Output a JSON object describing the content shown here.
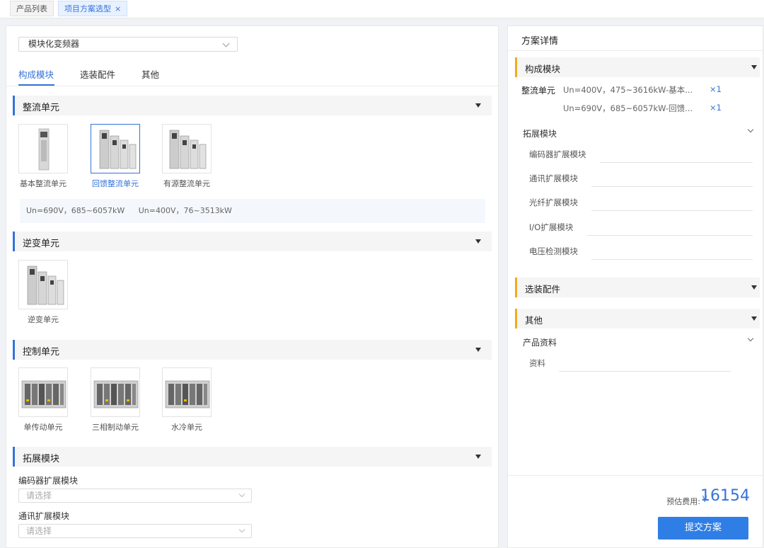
{
  "tabs": [
    {
      "label": "产品列表"
    },
    {
      "label": "项目方案选型",
      "close": "×"
    }
  ],
  "left": {
    "product_select": "模块化变频器",
    "subtabs": [
      "构成模块",
      "选装配件",
      "其他"
    ],
    "sections": {
      "rectifier": {
        "title": "整流单元",
        "cards": [
          "基本整流单元",
          "回馈整流单元",
          "有源整流单元"
        ],
        "info": [
          "Un=690V，685~6057kW",
          "Un=400V，76~3513kW"
        ]
      },
      "inverter": {
        "title": "逆变单元",
        "cards": [
          "逆变单元"
        ]
      },
      "control": {
        "title": "控制单元",
        "cards": [
          "单传动单元",
          "三相制动单元",
          "水冷单元"
        ]
      },
      "extension": {
        "title": "拓展模块",
        "fields": [
          {
            "label": "编码器扩展模块",
            "placeholder": "请选择"
          },
          {
            "label": "通讯扩展模块",
            "placeholder": "请选择"
          }
        ]
      }
    }
  },
  "right": {
    "title": "方案详情",
    "composition": {
      "title": "构成模块",
      "rectifier_label": "整流单元",
      "rows": [
        {
          "text": "Un=400V，475~3616kW-基本...",
          "qty": "×1"
        },
        {
          "text": "Un=690V，685~6057kW-回馈...",
          "qty": "×1"
        }
      ]
    },
    "extension": {
      "title": "拓展模块",
      "items": [
        "编码器扩展模块",
        "通讯扩展模块",
        "光纤扩展模块",
        "I/O扩展模块",
        "电压检测模块"
      ]
    },
    "options": {
      "title": "选装配件"
    },
    "other": {
      "title": "其他",
      "sub_title": "产品资料",
      "field": "资料"
    },
    "footer": {
      "price_label": "预估费用:",
      "currency": "¥",
      "price": "16154",
      "submit": "提交方案"
    }
  },
  "colors": {
    "accent": "#3573d8",
    "warning_bar": "#f0ad1c",
    "submit": "#2f7ee6"
  }
}
